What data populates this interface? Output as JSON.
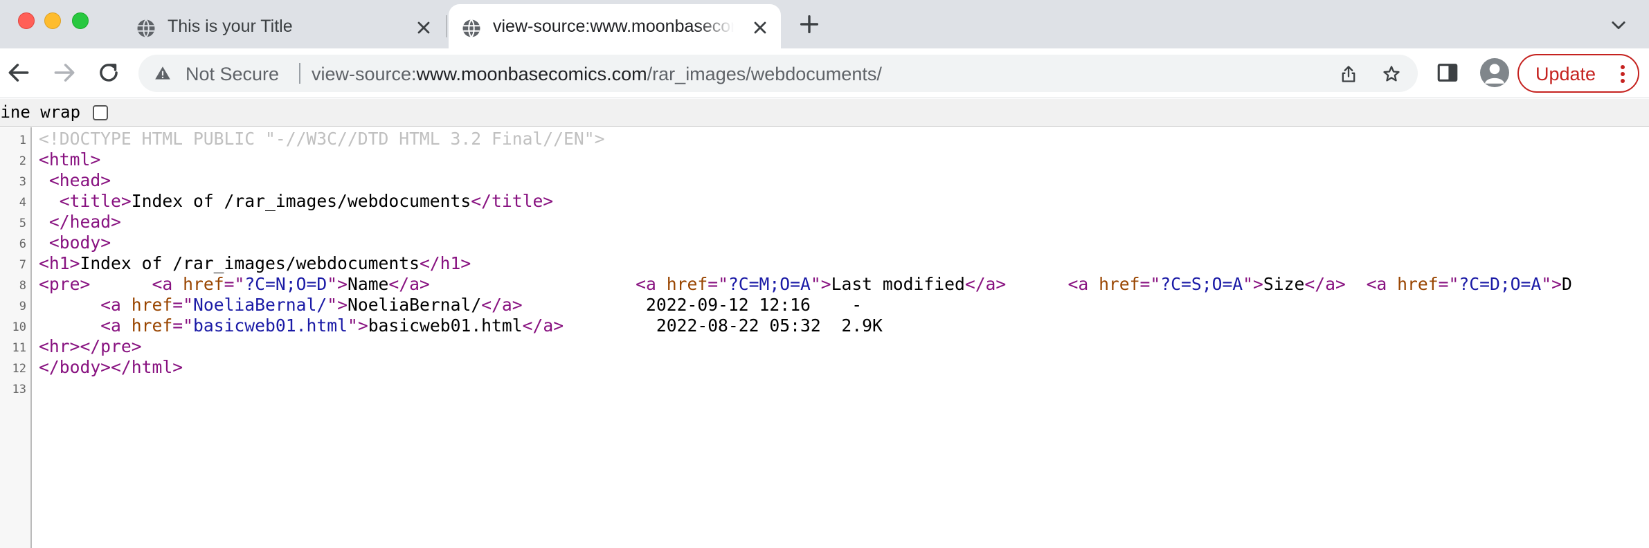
{
  "tabs": [
    {
      "title": "This is your Title",
      "active": false
    },
    {
      "title": "view-source:www.moonbasecomics.com/rar_images/webdocuments/",
      "active": true
    }
  ],
  "omnibox": {
    "security": "Not Secure",
    "url_scheme": "view-source:",
    "url_host": "www.moonbasecomics.com",
    "url_path": "/rar_images/webdocuments/"
  },
  "toolbar": {
    "update_label": "Update"
  },
  "wrap": {
    "label": "Line wrap",
    "checked": false
  },
  "source": {
    "line_numbers": [
      "1",
      "2",
      "3",
      "4",
      "5",
      "6",
      "7",
      "8",
      "9",
      "10",
      "11",
      "12",
      "13"
    ],
    "l1": "<!DOCTYPE HTML PUBLIC \"-//W3C//DTD HTML 3.2 Final//EN\">",
    "l2_tag": "<html>",
    "l3_tag": "<head>",
    "l4_open": "<title>",
    "l4_text": "Index of /rar_images/webdocuments",
    "l4_close": "</title>",
    "l5_tag": "</head>",
    "l6_tag": "<body>",
    "l7_open": "<h1>",
    "l7_text": "Index of /rar_images/webdocuments",
    "l7_close": "</h1>",
    "l8": {
      "pre": "<pre>",
      "a_open": "<a ",
      "href_attr": "href",
      "eq": "=",
      "q": "\"",
      "gt": ">",
      "a_close": "</a>",
      "name_href": "?C=N;O=D",
      "name_text": "Name",
      "mod_href": "?C=M;O=A",
      "mod_text": "Last modified",
      "size_href": "?C=S;O=A",
      "size_text": "Size",
      "desc_href": "?C=D;O=A",
      "desc_text": "D"
    },
    "l9": {
      "href": "NoeliaBernal/",
      "text": "NoeliaBernal/",
      "meta": "2022-09-12 12:16    -"
    },
    "l10": {
      "href": "basicweb01.html",
      "text": "basicweb01.html",
      "meta": "2022-08-22 05:32  2.9K"
    },
    "l11_open": "<hr>",
    "l11_close": "</pre>",
    "l12_open": "</body>",
    "l12_close": "</html>"
  }
}
